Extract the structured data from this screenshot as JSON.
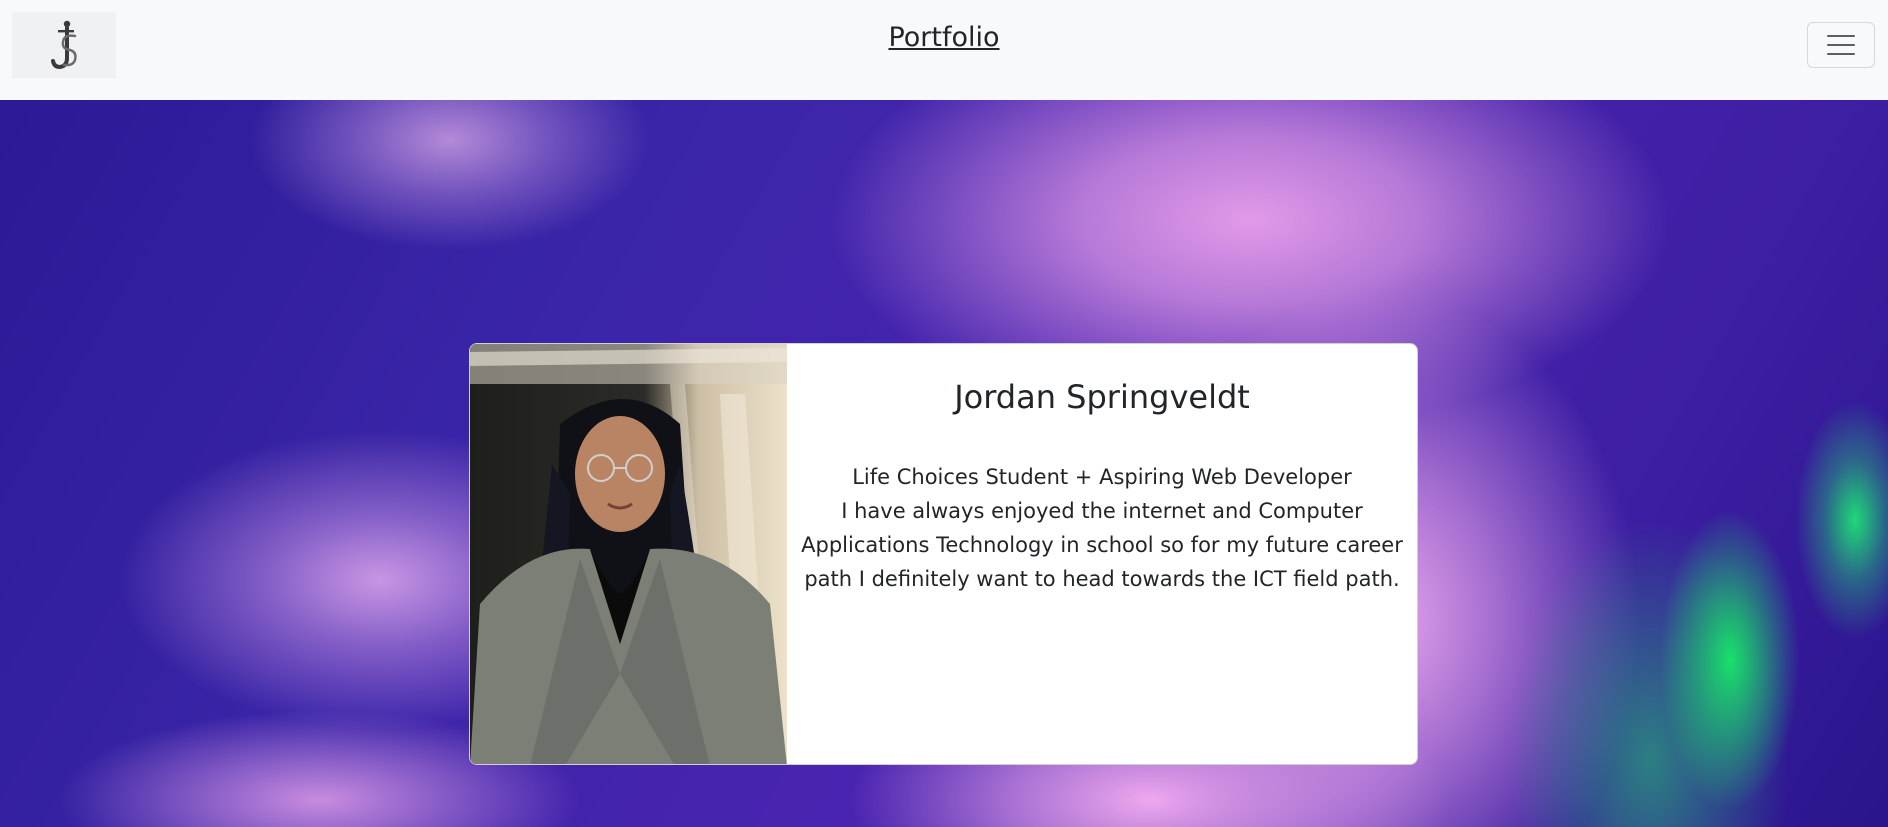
{
  "navbar": {
    "brand_icon": "js-monogram-logo",
    "title": "Portfolio",
    "menu_icon": "hamburger-menu-icon"
  },
  "profile": {
    "name": "Jordan Springveldt",
    "tagline": "Life Choices Student + Aspiring Web Developer",
    "bio": "I have always enjoyed the internet and Computer Applications Technology in school so for my future career path I definitely want to head towards the ICT field path."
  },
  "colors": {
    "navbar_bg": "#f8f9fa",
    "text": "#212529",
    "hero_purple": "#3a25a8",
    "hero_pink": "#e19ae8",
    "hero_green": "#19e06a"
  }
}
